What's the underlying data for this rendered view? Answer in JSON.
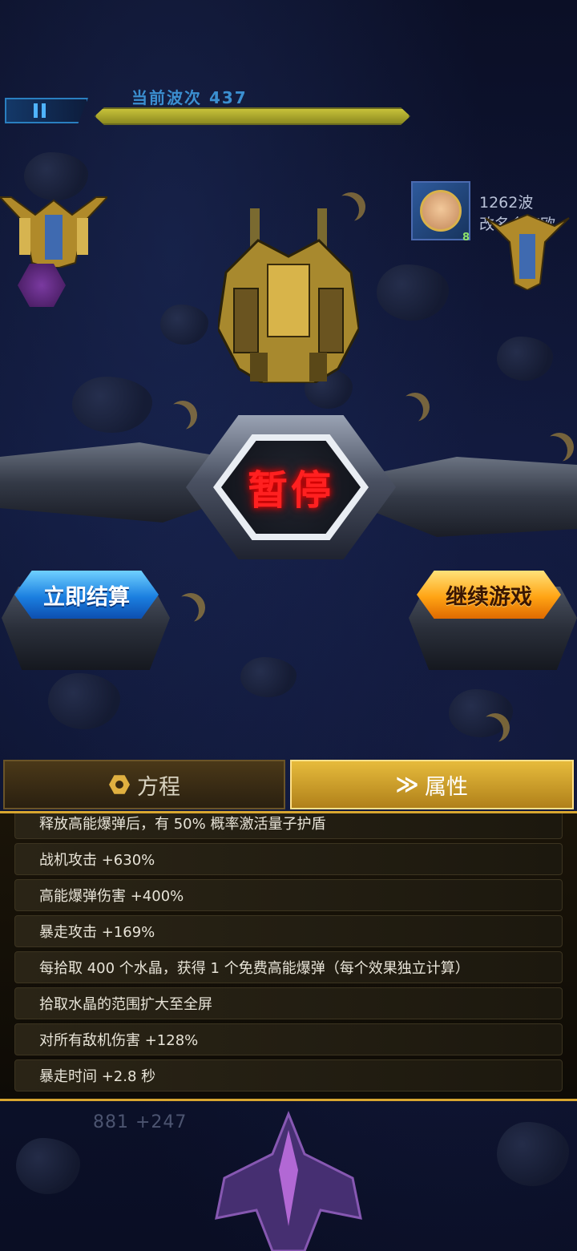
{
  "hud": {
    "wave_label": "当前波次 437",
    "wave_progress": 1.0
  },
  "player": {
    "waves": "1262波",
    "name": "改名会变欧",
    "level": "8"
  },
  "pause": {
    "title": "暂停"
  },
  "actions": {
    "settle_label": "立即结算",
    "continue_label": "继续游戏"
  },
  "tabs": {
    "formula_label": "方程",
    "attributes_label": "属性",
    "active": "attributes"
  },
  "attributes": {
    "items": [
      "释放高能爆弹后，有 50% 概率激活量子护盾",
      "战机攻击 +630%",
      "高能爆弹伤害 +400%",
      "暴走攻击 +169%",
      "每拾取 400 个水晶，获得 1 个免费高能爆弹（每个效果独立计算）",
      "拾取水晶的范围扩大至全屏",
      "对所有敌机伤害 +128%",
      "暴走时间 +2.8 秒"
    ]
  },
  "bottom_hud": {
    "score_readout": "881 +247"
  },
  "colors": {
    "pause_title": "#ff2020",
    "settle_button": "#1b7fe0",
    "continue_button": "#ffa414",
    "panel_border": "#d8a630"
  }
}
